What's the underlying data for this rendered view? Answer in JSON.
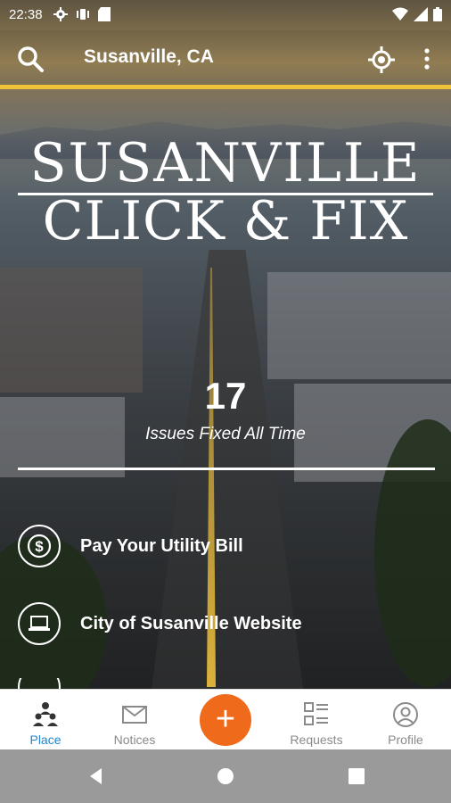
{
  "status_bar": {
    "time": "22:38"
  },
  "header": {
    "location": "Susanville, CA"
  },
  "hero": {
    "title_line1": "SUSANVILLE",
    "title_line2": "CLICK & FIX"
  },
  "stats": {
    "count": "17",
    "caption": "Issues Fixed All Time"
  },
  "links": [
    {
      "label": "Pay Your Utility Bill",
      "icon": "dollar-icon"
    },
    {
      "label": "City of Susanville Website",
      "icon": "laptop-icon"
    }
  ],
  "bottom_nav": {
    "place": "Place",
    "notices": "Notices",
    "add": "+",
    "requests": "Requests",
    "profile": "Profile"
  },
  "colors": {
    "accent": "#1c86d3",
    "fab": "#f06a1c",
    "underline": "#f0c23a"
  }
}
